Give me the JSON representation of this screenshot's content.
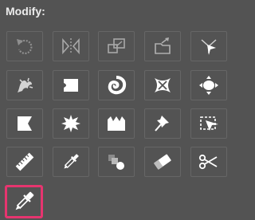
{
  "panel": {
    "title": "Modify:",
    "tools": [
      {
        "icon": "undo-arrow-icon"
      },
      {
        "icon": "flip-horizontal-icon"
      },
      {
        "icon": "scale-icon"
      },
      {
        "icon": "export-folder-icon"
      },
      {
        "icon": "branch-node-icon"
      },
      {
        "icon": "thorn-warp-icon"
      },
      {
        "icon": "pucker-icon"
      },
      {
        "icon": "twirl-icon"
      },
      {
        "icon": "pinch-icon"
      },
      {
        "icon": "bloat-icon"
      },
      {
        "icon": "flag-pinch-icon"
      },
      {
        "icon": "crystallize-icon"
      },
      {
        "icon": "wrinkle-icon"
      },
      {
        "icon": "pin-icon"
      },
      {
        "icon": "envelope-distort-icon"
      },
      {
        "icon": "ruler-icon"
      },
      {
        "icon": "eyedropper-icon"
      },
      {
        "icon": "blend-icon"
      },
      {
        "icon": "eraser-icon"
      },
      {
        "icon": "scissors-icon"
      },
      {
        "icon": "color-picker-icon"
      }
    ],
    "selected_tool": "color-picker-icon",
    "colors": {
      "background": "#535353",
      "cell_border": "#666666",
      "icon_fill": "#ffffff",
      "selection_border": "#e6356f"
    }
  }
}
